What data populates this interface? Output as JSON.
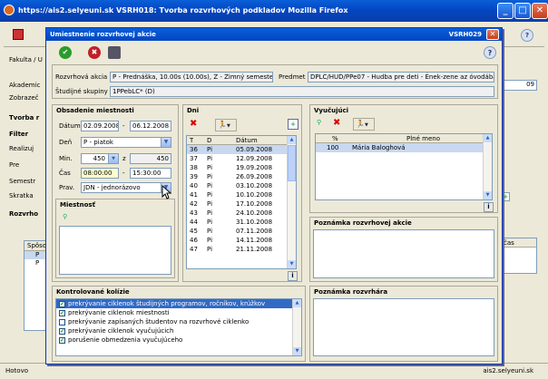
{
  "browser": {
    "title": "https://ais2.selyeuni.sk   VSRH018: Tvorba rozvrhových podkladov   Mozilla Firefox",
    "status_left": "Hotovo",
    "status_right": "ais2.selyeuni.sk"
  },
  "background": {
    "left_labels": [
      "Fakulta / U",
      "Akademic",
      "Zobrazeč",
      "Tvorba r",
      "Filter",
      "Realizuj",
      "Pre",
      "Semestr",
      "Skratka",
      "Rozvrho"
    ],
    "right_value": "09",
    "grid_header": "Spôso",
    "grid_rows": [
      "P",
      "P"
    ],
    "right_grid_header": "čas"
  },
  "dialog": {
    "title": "Umiestnenie rozvrhovej akcie",
    "code": "VSRH029",
    "header": {
      "akcia_label": "Rozvrhová akcia",
      "akcia_value": "P - Prednáška, 10.00s (10.00s), Z - Zimný semester",
      "predmet_label": "Predmet",
      "predmet_value": "DPLC/HUD/PPe07 - Hudba pre deti - Ének-zene az óvodában",
      "skupiny_label": "Študijné skupiny",
      "skupiny_value": "1PPebLC* (D)"
    },
    "obsadenie": {
      "title": "Obsadenie miestnosti",
      "datum_label": "Dátum",
      "datum_from": "02.09.2008",
      "datum_sep": "-",
      "datum_to": "06.12.2008",
      "den_label": "Deň",
      "den_value": "P - piatok",
      "min_label": "Min.",
      "min_value": "450",
      "min_z": "z",
      "min_total": "450",
      "cas_label": "Čas",
      "cas_from": "08:00:00",
      "cas_sep": "-",
      "cas_to": "15:30:00",
      "prav_label": "Prav.",
      "prav_value": "JDN - jednorázovo",
      "miestnost_title": "Miestnosť"
    },
    "dni": {
      "title": "Dni",
      "headers": [
        "T",
        "D",
        "Dátum"
      ],
      "rows": [
        [
          "36",
          "Pi",
          "05.09.2008"
        ],
        [
          "37",
          "Pi",
          "12.09.2008"
        ],
        [
          "38",
          "Pi",
          "19.09.2008"
        ],
        [
          "39",
          "Pi",
          "26.09.2008"
        ],
        [
          "40",
          "Pi",
          "03.10.2008"
        ],
        [
          "41",
          "Pi",
          "10.10.2008"
        ],
        [
          "42",
          "Pi",
          "17.10.2008"
        ],
        [
          "43",
          "Pi",
          "24.10.2008"
        ],
        [
          "44",
          "Pi",
          "31.10.2008"
        ],
        [
          "45",
          "Pi",
          "07.11.2008"
        ],
        [
          "46",
          "Pi",
          "14.11.2008"
        ],
        [
          "47",
          "Pi",
          "21.11.2008"
        ]
      ],
      "info_btn": "i"
    },
    "vyucujuci": {
      "title": "Vyučujúci",
      "headers": [
        "%",
        "Plné meno"
      ],
      "rows": [
        [
          "100",
          "Mária Baloghová"
        ]
      ],
      "info_btn": "i"
    },
    "poznamka_akcie": {
      "title": "Poznámka rozvrhovej akcie"
    },
    "poznamka_rozvrhara": {
      "title": "Poznámka rozvrhára"
    },
    "kolizie": {
      "title": "Kontrolované kolízie",
      "items": [
        {
          "label": "prekrývanie ciklenok študijných programov, ročníkov, krúžkov",
          "checked": true,
          "selected": true
        },
        {
          "label": "prekrývanie ciklenok miestnosti",
          "checked": true,
          "selected": false
        },
        {
          "label": "prekrývanie zapísaných študentov na rozvrhové ciklenko",
          "checked": false,
          "selected": false
        },
        {
          "label": "prekrývanie ciklenok vyučujúcich",
          "checked": true,
          "selected": false
        },
        {
          "label": "porušenie obmedzenia vyučujúceho",
          "checked": true,
          "selected": false
        }
      ]
    }
  },
  "icons": {
    "check": "✔",
    "remove": "✖",
    "dropdown": "▼",
    "help": "?",
    "close": "✕",
    "add": "+",
    "person": "🏃",
    "minimize": "_",
    "maximize": "□"
  }
}
